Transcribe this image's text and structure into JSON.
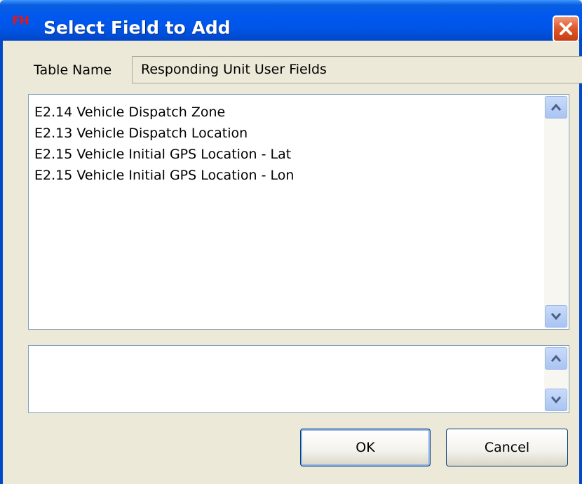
{
  "window": {
    "title": "Select Field to Add",
    "app_icon_text": "FH",
    "accent_color": "#0058ee",
    "close_color": "#e05a2e"
  },
  "form": {
    "table_name_label": "Table Name",
    "table_name_value": "Responding Unit User Fields"
  },
  "fields": {
    "items": [
      {
        "label": "E2.14 Vehicle Dispatch Zone"
      },
      {
        "label": "E2.13 Vehicle Dispatch Location"
      },
      {
        "label": "E2.15 Vehicle Initial GPS Location - Lat"
      },
      {
        "label": "E2.15 Vehicle Initial GPS Location - Lon"
      }
    ]
  },
  "description": {
    "text": ""
  },
  "buttons": {
    "ok_label": "OK",
    "cancel_label": "Cancel"
  },
  "icons": {
    "close": "close-icon",
    "scroll_up": "chevron-up-icon",
    "scroll_down": "chevron-down-icon"
  }
}
